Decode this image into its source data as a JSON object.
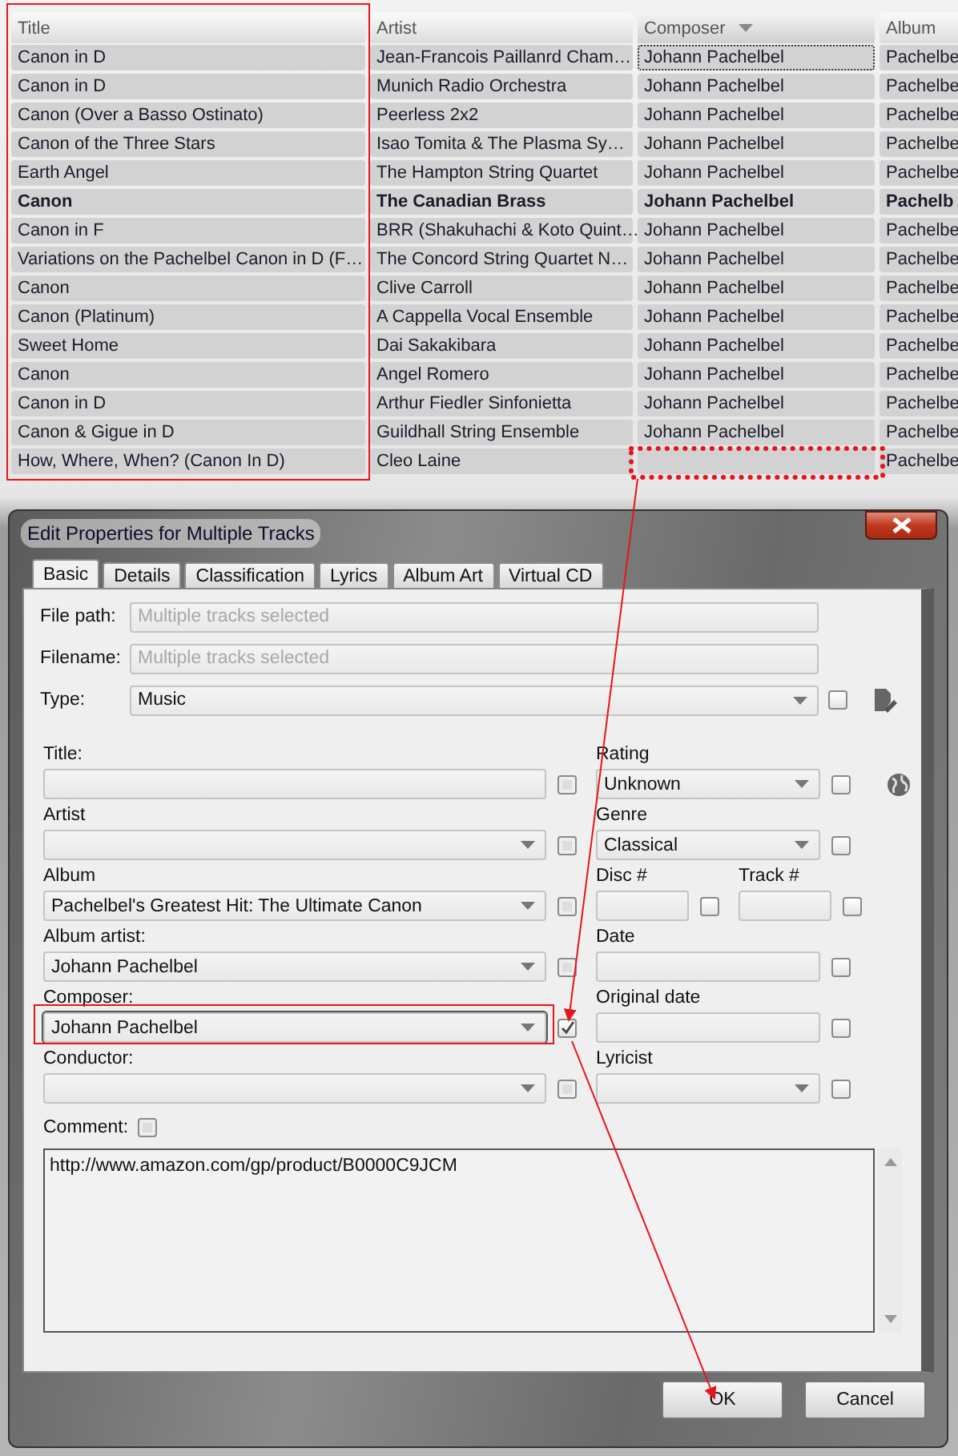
{
  "track_list": {
    "columns": [
      {
        "label": "Title",
        "sorted": false
      },
      {
        "label": "Artist",
        "sorted": false
      },
      {
        "label": "Composer",
        "sorted": true
      },
      {
        "label": "Album",
        "sorted": false
      }
    ],
    "rows": [
      {
        "cells": [
          "Canon in D",
          "Jean-Francois Paillanrd Cham…",
          "Johann Pachelbel",
          "Pachelbe"
        ],
        "bold": false,
        "focused": true
      },
      {
        "cells": [
          "Canon in D",
          "Munich Radio Orchestra",
          "Johann Pachelbel",
          "Pachelbe"
        ],
        "bold": false,
        "focused": false
      },
      {
        "cells": [
          "Canon (Over a Basso Ostinato)",
          "Peerless 2x2",
          "Johann Pachelbel",
          "Pachelbe"
        ],
        "bold": false,
        "focused": false
      },
      {
        "cells": [
          "Canon of the Three Stars",
          "Isao Tomita & The Plasma Sy…",
          "Johann Pachelbel",
          "Pachelbe"
        ],
        "bold": false,
        "focused": false
      },
      {
        "cells": [
          "Earth Angel",
          "The Hampton String Quartet",
          "Johann Pachelbel",
          "Pachelbe"
        ],
        "bold": false,
        "focused": false
      },
      {
        "cells": [
          "Canon",
          "The Canadian Brass",
          "Johann Pachelbel",
          "Pachelb"
        ],
        "bold": true,
        "focused": false
      },
      {
        "cells": [
          "Canon in F",
          "BRR (Shakuhachi & Koto Quint…",
          "Johann Pachelbel",
          "Pachelbe"
        ],
        "bold": false,
        "focused": false
      },
      {
        "cells": [
          "Variations on the Pachelbel Canon in D (F…",
          "The Concord String Quartet N…",
          "Johann Pachelbel",
          "Pachelbe"
        ],
        "bold": false,
        "focused": false
      },
      {
        "cells": [
          "Canon",
          "Clive Carroll",
          "Johann Pachelbel",
          "Pachelbe"
        ],
        "bold": false,
        "focused": false
      },
      {
        "cells": [
          "Canon (Platinum)",
          "A Cappella Vocal Ensemble",
          "Johann Pachelbel",
          "Pachelbe"
        ],
        "bold": false,
        "focused": false
      },
      {
        "cells": [
          "Sweet Home",
          "Dai Sakakibara",
          "Johann Pachelbel",
          "Pachelbe"
        ],
        "bold": false,
        "focused": false
      },
      {
        "cells": [
          "Canon",
          "Angel Romero",
          "Johann Pachelbel",
          "Pachelbe"
        ],
        "bold": false,
        "focused": false
      },
      {
        "cells": [
          "Canon in D",
          "Arthur Fiedler Sinfonietta",
          "Johann Pachelbel",
          "Pachelbe"
        ],
        "bold": false,
        "focused": false
      },
      {
        "cells": [
          "Canon & Gigue in D",
          "Guildhall String Ensemble",
          "Johann Pachelbel",
          "Pachelbe"
        ],
        "bold": false,
        "focused": false
      },
      {
        "cells": [
          "How, Where, When? (Canon In D)",
          "Cleo Laine",
          "",
          "Pachelbe"
        ],
        "bold": false,
        "focused": false
      }
    ]
  },
  "dialog": {
    "title": "Edit Properties for Multiple Tracks",
    "tabs": [
      {
        "label": "Basic",
        "selected": true
      },
      {
        "label": "Details",
        "selected": false
      },
      {
        "label": "Classification",
        "selected": false
      },
      {
        "label": "Lyrics",
        "selected": false
      },
      {
        "label": "Album Art",
        "selected": false
      },
      {
        "label": "Virtual CD",
        "selected": false
      }
    ],
    "top_fields": [
      {
        "label": "File path:",
        "placeholder": "Multiple tracks selected",
        "kind": "text"
      },
      {
        "label": "Filename:",
        "placeholder": "Multiple tracks selected",
        "kind": "text"
      },
      {
        "label": "Type:",
        "value": "Music",
        "kind": "combo",
        "checked": false
      }
    ],
    "rows": [
      {
        "left": {
          "label": "Title:",
          "kind": "text",
          "checked": false,
          "disabled": true
        },
        "right": [
          {
            "label": "Rating",
            "value": "Unknown",
            "kind": "combo",
            "checked": false,
            "disabled": false
          }
        ]
      },
      {
        "left": {
          "label": "Artist",
          "kind": "combo",
          "checked": false,
          "disabled": true
        },
        "right": [
          {
            "label": "Genre",
            "value": "Classical",
            "kind": "combo",
            "checked": false,
            "disabled": false
          }
        ]
      },
      {
        "left": {
          "label": "Album",
          "value": "Pachelbel's Greatest Hit: The Ultimate Canon",
          "kind": "combo",
          "checked": false,
          "disabled": true
        },
        "right": [
          {
            "label": "Disc #",
            "kind": "text",
            "checked": false,
            "disabled": false
          },
          {
            "label": "Track #",
            "kind": "text",
            "checked": false,
            "disabled": false
          }
        ]
      },
      {
        "left": {
          "label": "Album artist:",
          "value": "Johann Pachelbel",
          "kind": "combo",
          "checked": false,
          "disabled": true
        },
        "right": [
          {
            "label": "Date",
            "kind": "text",
            "checked": false,
            "disabled": false
          }
        ]
      },
      {
        "left": {
          "label": "Composer:",
          "value": "Johann Pachelbel",
          "kind": "combo",
          "checked": true,
          "disabled": false
        },
        "right": [
          {
            "label": "Original date",
            "kind": "text",
            "checked": false,
            "disabled": false
          }
        ]
      },
      {
        "left": {
          "label": "Conductor:",
          "kind": "combo",
          "checked": false,
          "disabled": true
        },
        "right": [
          {
            "label": "Lyricist",
            "kind": "combo",
            "checked": false,
            "disabled": false
          }
        ]
      }
    ],
    "comment": {
      "label": "Comment:",
      "checked": false,
      "disabled": true,
      "value": "http://www.amazon.com/gp/product/B0000C9JCM"
    },
    "buttons": [
      {
        "label": "OK"
      },
      {
        "label": "Cancel"
      }
    ]
  }
}
